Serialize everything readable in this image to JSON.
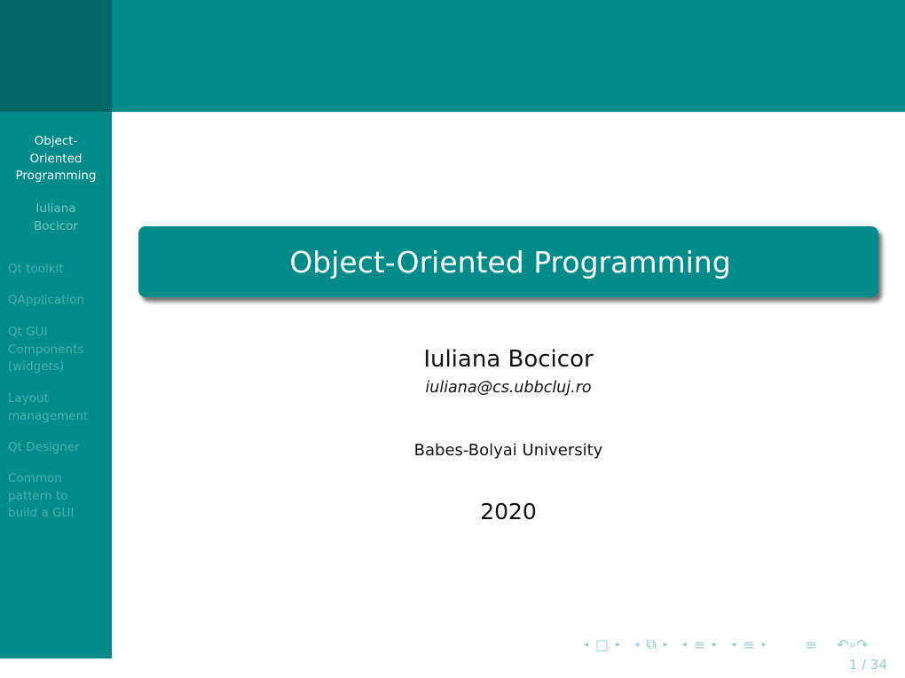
{
  "sidebar": {
    "title": "Object-\nOriented\nProgramming",
    "author": "Iuliana\nBocicor",
    "items": [
      {
        "label": "Qt toolkit"
      },
      {
        "label": "QApplication"
      },
      {
        "label": "Qt GUI\nComponents\n(widgets)"
      },
      {
        "label": "Layout\nmanagement"
      },
      {
        "label": "Qt Designer"
      },
      {
        "label": "Common\npattern to\nbuild a GUI"
      }
    ]
  },
  "slide": {
    "title": "Object-Oriented Programming",
    "author": "Iuliana Bocicor",
    "email": "iuliana@cs.ubbcluj.ro",
    "institution": "Babes-Bolyai University",
    "year": "2020"
  },
  "navigation": {
    "icons": {
      "prev": "◂",
      "next": "▸",
      "frame": "□",
      "subsection": "⧉",
      "section": "≡",
      "document": "≡",
      "back": "↶",
      "search": "⌕",
      "forward": "↷"
    },
    "page_indicator": "1 / 34"
  },
  "colors": {
    "header_dark": "#006666",
    "accent": "#008b8b",
    "sidebar_inactive_text": "#4fb0b0"
  }
}
